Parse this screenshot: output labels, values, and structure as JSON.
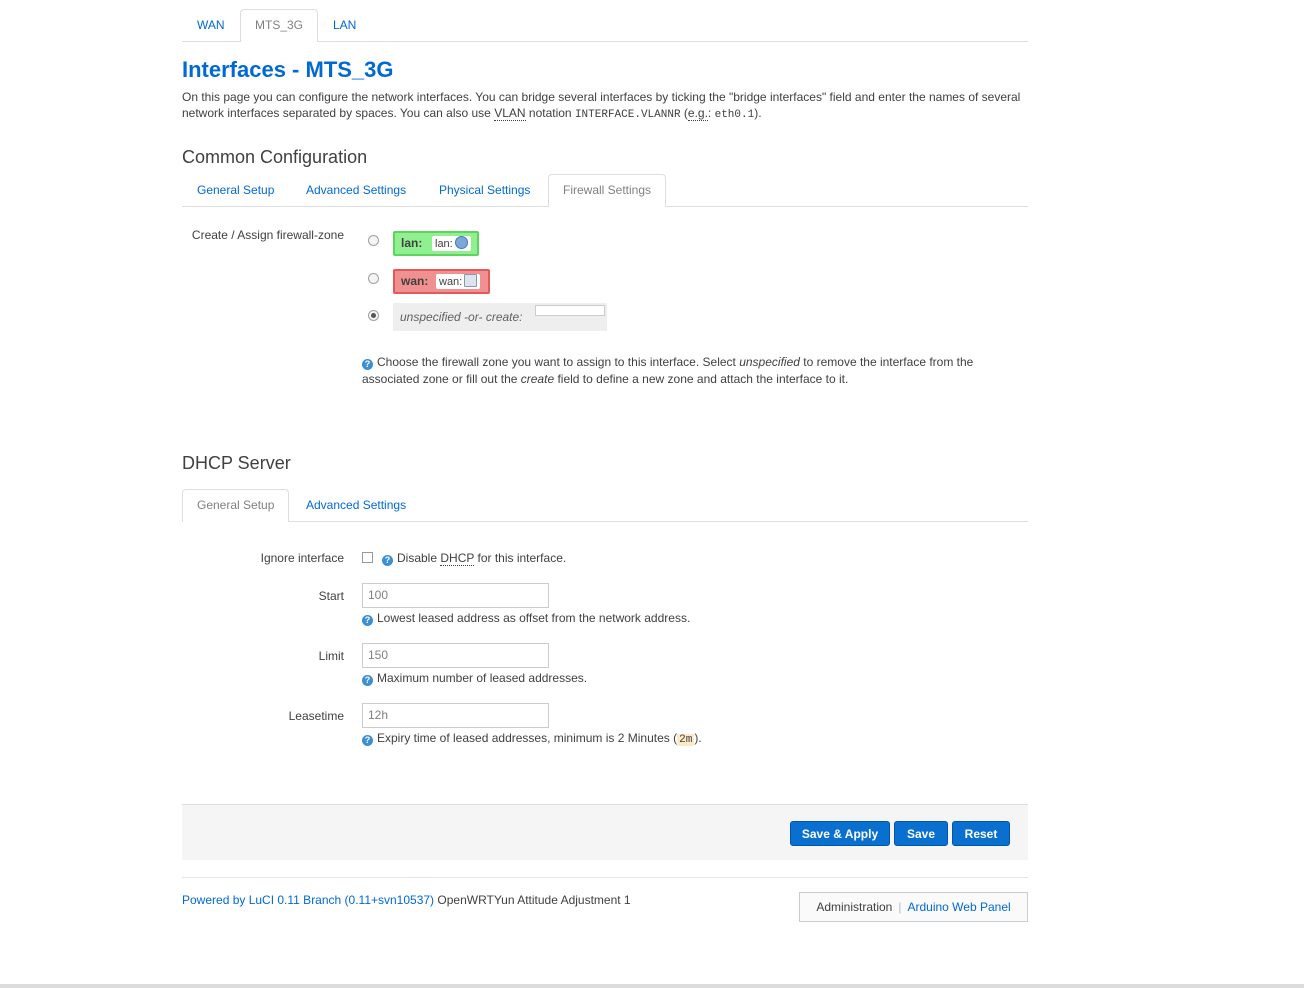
{
  "top_tabs": [
    {
      "label": "WAN",
      "active": false
    },
    {
      "label": "MTS_3G",
      "active": true
    },
    {
      "label": "LAN",
      "active": false
    }
  ],
  "page": {
    "title": "Interfaces - MTS_3G",
    "desc_part1": "On this page you can configure the network interfaces. You can bridge several interfaces by ticking the \"bridge interfaces\" field and enter the names of several network interfaces separated by spaces. You can also use ",
    "desc_vlan": "VLAN",
    "desc_part2": " notation ",
    "desc_code1": "INTERFACE.VLANNR",
    "desc_part3": " (",
    "desc_eg": "e.g.",
    "desc_part4": ": ",
    "desc_code2": "eth0.1",
    "desc_part5": ")."
  },
  "common_config": {
    "heading": "Common Configuration",
    "tabs": [
      {
        "label": "General Setup",
        "active": false
      },
      {
        "label": "Advanced Settings",
        "active": false
      },
      {
        "label": "Physical Settings",
        "active": false
      },
      {
        "label": "Firewall Settings",
        "active": true
      }
    ],
    "firewall_label": "Create / Assign firewall-zone",
    "zones": [
      {
        "name": "lan:",
        "inner": "lan:",
        "color": "#90f090",
        "border": "#5fd35f",
        "icon": "network-icon"
      },
      {
        "name": "wan:",
        "inner": "wan:",
        "color": "#f09090",
        "border": "#e05a5a",
        "icon": "wireless-icon"
      }
    ],
    "unspecified_label": "unspecified -or- create:",
    "help_a": "Choose the firewall zone you want to assign to this interface. Select ",
    "help_em1": "unspecified",
    "help_b": " to remove the interface from the associated zone or fill out the ",
    "help_em2": "create",
    "help_c": " field to define a new zone and attach the interface to it."
  },
  "dhcp": {
    "heading": "DHCP Server",
    "tabs": [
      {
        "label": "General Setup",
        "active": true
      },
      {
        "label": "Advanced Settings",
        "active": false
      }
    ],
    "ignore_label": "Ignore interface",
    "ignore_help_a": "Disable ",
    "ignore_help_abbr": "DHCP",
    "ignore_help_b": " for this interface.",
    "start_label": "Start",
    "start_value": "100",
    "start_help": "Lowest leased address as offset from the network address.",
    "limit_label": "Limit",
    "limit_value": "150",
    "limit_help": "Maximum number of leased addresses.",
    "leasetime_label": "Leasetime",
    "leasetime_value": "12h",
    "leasetime_help_a": "Expiry time of leased addresses, minimum is 2 Minutes (",
    "leasetime_help_code": "2m",
    "leasetime_help_b": ")."
  },
  "actions": {
    "save_apply": "Save & Apply",
    "save": "Save",
    "reset": "Reset"
  },
  "footer": {
    "powered": "Powered by LuCI 0.11 Branch (0.11+svn10537)",
    "version": " OpenWRTYun Attitude Adjustment 1",
    "menu_admin": "Administration",
    "menu_sep": "|",
    "menu_arduino": "Arduino Web Panel"
  }
}
